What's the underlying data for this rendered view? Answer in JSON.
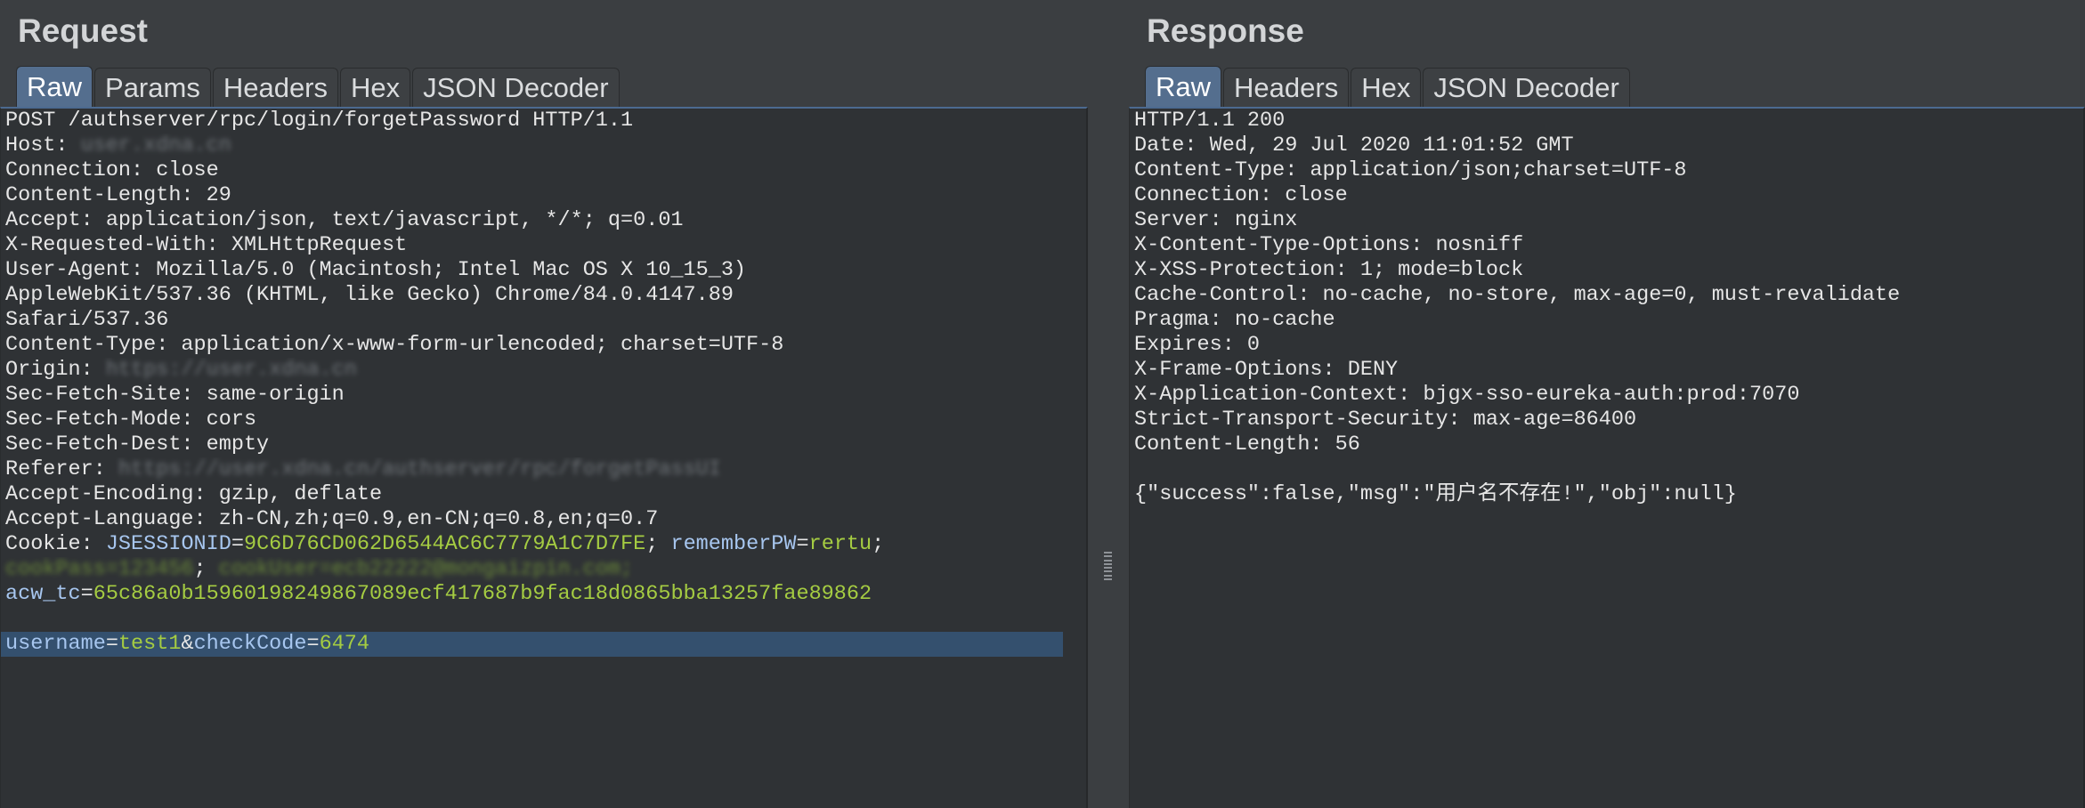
{
  "request": {
    "title": "Request",
    "tabs": [
      "Raw",
      "Params",
      "Headers",
      "Hex",
      "JSON Decoder"
    ],
    "active_tab": "Raw",
    "lines": {
      "l1": "POST /authserver/rpc/login/forgetPassword HTTP/1.1",
      "l2_label": "Host: ",
      "l2_blur": "user.xdna.cn",
      "l3": "Connection: close",
      "l4": "Content-Length: 29",
      "l5": "Accept: application/json, text/javascript, */*; q=0.01",
      "l6": "X-Requested-With: XMLHttpRequest",
      "l7": "User-Agent: Mozilla/5.0 (Macintosh; Intel Mac OS X 10_15_3)",
      "l8": "AppleWebKit/537.36 (KHTML, like Gecko) Chrome/84.0.4147.89",
      "l9": "Safari/537.36",
      "l10": "Content-Type: application/x-www-form-urlencoded; charset=UTF-8",
      "l11_label": "Origin: ",
      "l11_blur": "https://user.xdna.cn",
      "l12": "Sec-Fetch-Site: same-origin",
      "l13": "Sec-Fetch-Mode: cors",
      "l14": "Sec-Fetch-Dest: empty",
      "l15_label": "Referer: ",
      "l15_blur": "https://user.xdna.cn/authserver/rpc/forgetPassUI",
      "l16": "Accept-Encoding: gzip, deflate",
      "l17": "Accept-Language: zh-CN,zh;q=0.9,en-CN;q=0.8,en;q=0.7",
      "cookie_label": "Cookie: ",
      "cookie1_key": "JSESSIONID",
      "cookie1_val": "9C6D76CD062D6544AC6C7779A1C7D7FE",
      "cookie2_key": "rememberPW",
      "cookie2_val": "rertu",
      "l19_blur1": "cookPass=123456",
      "l19_blur2": "cookUser=ecb22222@mongaizpin.com;",
      "acw_key": "acw_tc",
      "acw_val": "65c86a0b15960198249867089ecf417687b9fac18d0865bba13257fae89862",
      "body_k1": "username",
      "body_v1": "test1",
      "body_k2": "checkCode",
      "body_v2": "6474"
    }
  },
  "response": {
    "title": "Response",
    "tabs": [
      "Raw",
      "Headers",
      "Hex",
      "JSON Decoder"
    ],
    "active_tab": "Raw",
    "lines": [
      "HTTP/1.1 200",
      "Date: Wed, 29 Jul 2020 11:01:52 GMT",
      "Content-Type: application/json;charset=UTF-8",
      "Connection: close",
      "Server: nginx",
      "X-Content-Type-Options: nosniff",
      "X-XSS-Protection: 1; mode=block",
      "Cache-Control: no-cache, no-store, max-age=0, must-revalidate",
      "Pragma: no-cache",
      "Expires: 0",
      "X-Frame-Options: DENY",
      "X-Application-Context: bjgx-sso-eureka-auth:prod:7070",
      "Strict-Transport-Security: max-age=86400",
      "Content-Length: 56",
      "",
      "{\"success\":false,\"msg\":\"用户名不存在!\",\"obj\":null}"
    ]
  },
  "colors": {
    "background": "#3b3e41",
    "editor_bg": "#2f3235",
    "active_tab": "#546e8e",
    "param_key": "#a7c6ef",
    "param_value": "#a5cc42",
    "selection": "#34506e"
  }
}
